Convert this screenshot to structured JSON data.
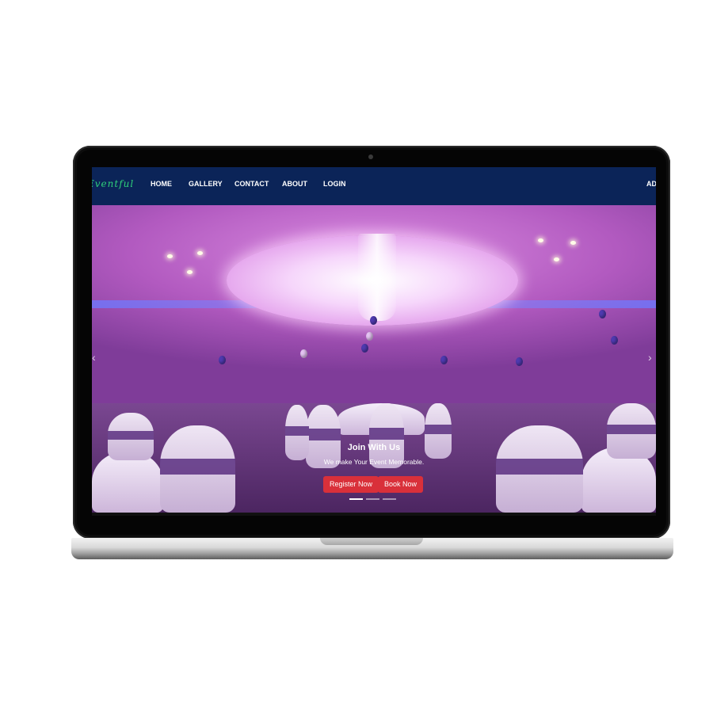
{
  "navbar": {
    "brand": "Eventful",
    "items": [
      "HOME",
      "GALLERY",
      "CONTACT",
      "ABOUT",
      "LOGIN"
    ],
    "right_item": "AD"
  },
  "hero": {
    "title": "Join With Us",
    "subtitle": "We make Your Event Memorable.",
    "buttons": {
      "register": "Register Now",
      "book": "Book Now"
    },
    "slide_count": 3,
    "active_slide": 1,
    "prev_icon": "chevron-left-icon",
    "next_icon": "chevron-right-icon"
  },
  "colors": {
    "navbar": "#0b2458",
    "brand": "#2fd07a",
    "button": "#d9303a"
  }
}
